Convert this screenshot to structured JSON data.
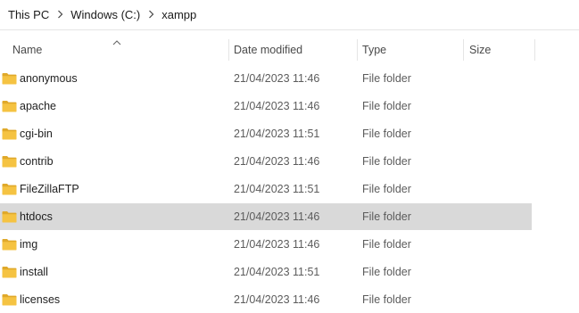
{
  "breadcrumb": {
    "items": [
      "This PC",
      "Windows (C:)",
      "xampp"
    ],
    "separator_icon": "chevron-right-icon"
  },
  "columns": {
    "name": "Name",
    "date_modified": "Date modified",
    "type": "Type",
    "size": "Size",
    "sorted_by": "Name",
    "sort_direction": "ascending"
  },
  "files": [
    {
      "name": "anonymous",
      "date": "21/04/2023 11:46",
      "type": "File folder",
      "icon": "folder-icon"
    },
    {
      "name": "apache",
      "date": "21/04/2023 11:46",
      "type": "File folder",
      "icon": "folder-icon"
    },
    {
      "name": "cgi-bin",
      "date": "21/04/2023 11:51",
      "type": "File folder",
      "icon": "folder-icon"
    },
    {
      "name": "contrib",
      "date": "21/04/2023 11:46",
      "type": "File folder",
      "icon": "folder-icon"
    },
    {
      "name": "FileZillaFTP",
      "date": "21/04/2023 11:51",
      "type": "File folder",
      "icon": "folder-icon"
    },
    {
      "name": "htdocs",
      "date": "21/04/2023 11:46",
      "type": "File folder",
      "icon": "folder-icon",
      "selected": true
    },
    {
      "name": "img",
      "date": "21/04/2023 11:46",
      "type": "File folder",
      "icon": "folder-icon"
    },
    {
      "name": "install",
      "date": "21/04/2023 11:51",
      "type": "File folder",
      "icon": "folder-icon"
    },
    {
      "name": "licenses",
      "date": "21/04/2023 11:46",
      "type": "File folder",
      "icon": "folder-icon"
    }
  ],
  "colors": {
    "folder": "#f5c342",
    "folder_dark": "#e0a92a",
    "selection": "#d9d9d9"
  }
}
